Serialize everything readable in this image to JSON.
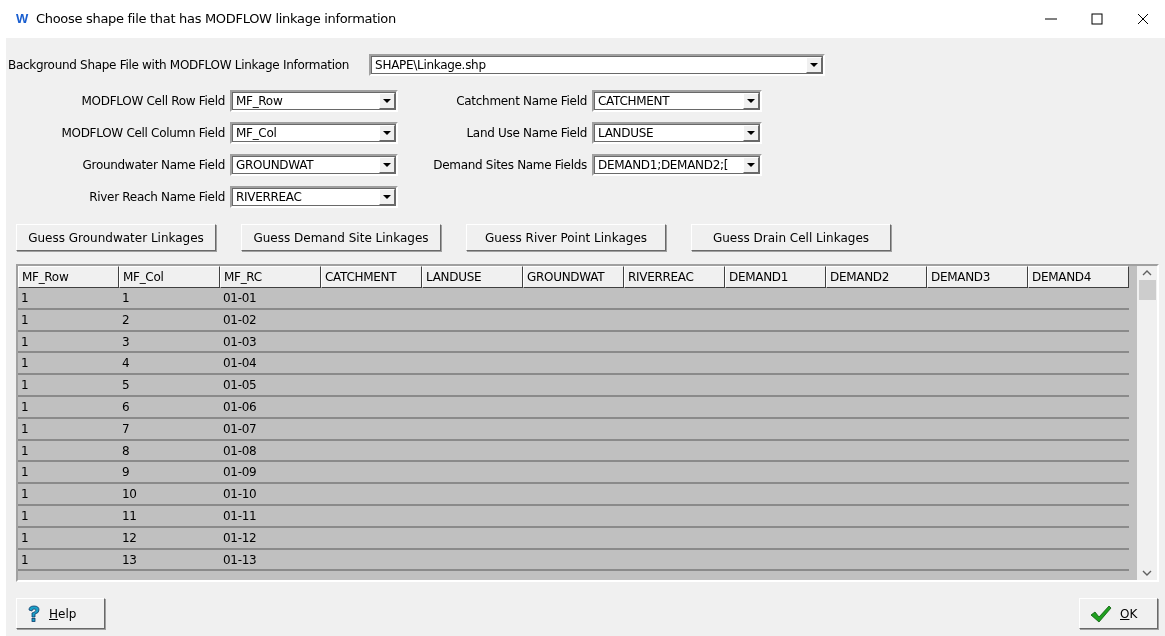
{
  "window": {
    "logo": "W",
    "title": "Choose shape file that has MODFLOW linkage information"
  },
  "shape_file": {
    "label": "Background Shape File with MODFLOW Linkage Information",
    "value": "SHAPE\\Linkage.shp"
  },
  "fields": [
    {
      "label": "MODFLOW Cell Row Field",
      "value": "MF_Row"
    },
    {
      "label": "Catchment Name Field",
      "value": "CATCHMENT"
    },
    {
      "label": "MODFLOW Cell Column Field",
      "value": "MF_Col"
    },
    {
      "label": "Land Use Name Field",
      "value": "LANDUSE"
    },
    {
      "label": "Groundwater Name Field",
      "value": "GROUNDWAT"
    },
    {
      "label": "Demand Sites Name Fields",
      "value": "DEMAND1;DEMAND2;["
    },
    {
      "label": "River Reach Name Field",
      "value": "RIVERREAC"
    }
  ],
  "buttons": [
    "Guess Groundwater Linkages",
    "Guess Demand Site Linkages",
    "Guess River Point Linkages",
    "Guess Drain Cell Linkages"
  ],
  "table": {
    "columns": [
      "MF_Row",
      "MF_Col",
      "MF_RC",
      "CATCHMENT",
      "LANDUSE",
      "GROUNDWAT",
      "RIVERREAC",
      "DEMAND1",
      "DEMAND2",
      "DEMAND3",
      "DEMAND4"
    ],
    "rows": [
      [
        "1",
        "1",
        "01-01"
      ],
      [
        "1",
        "2",
        "01-02"
      ],
      [
        "1",
        "3",
        "01-03"
      ],
      [
        "1",
        "4",
        "01-04"
      ],
      [
        "1",
        "5",
        "01-05"
      ],
      [
        "1",
        "6",
        "01-06"
      ],
      [
        "1",
        "7",
        "01-07"
      ],
      [
        "1",
        "8",
        "01-08"
      ],
      [
        "1",
        "9",
        "01-09"
      ],
      [
        "1",
        "10",
        "01-10"
      ],
      [
        "1",
        "11",
        "01-11"
      ],
      [
        "1",
        "12",
        "01-12"
      ],
      [
        "1",
        "13",
        "01-13"
      ]
    ]
  },
  "footer": {
    "help": "Help",
    "ok": "OK"
  }
}
